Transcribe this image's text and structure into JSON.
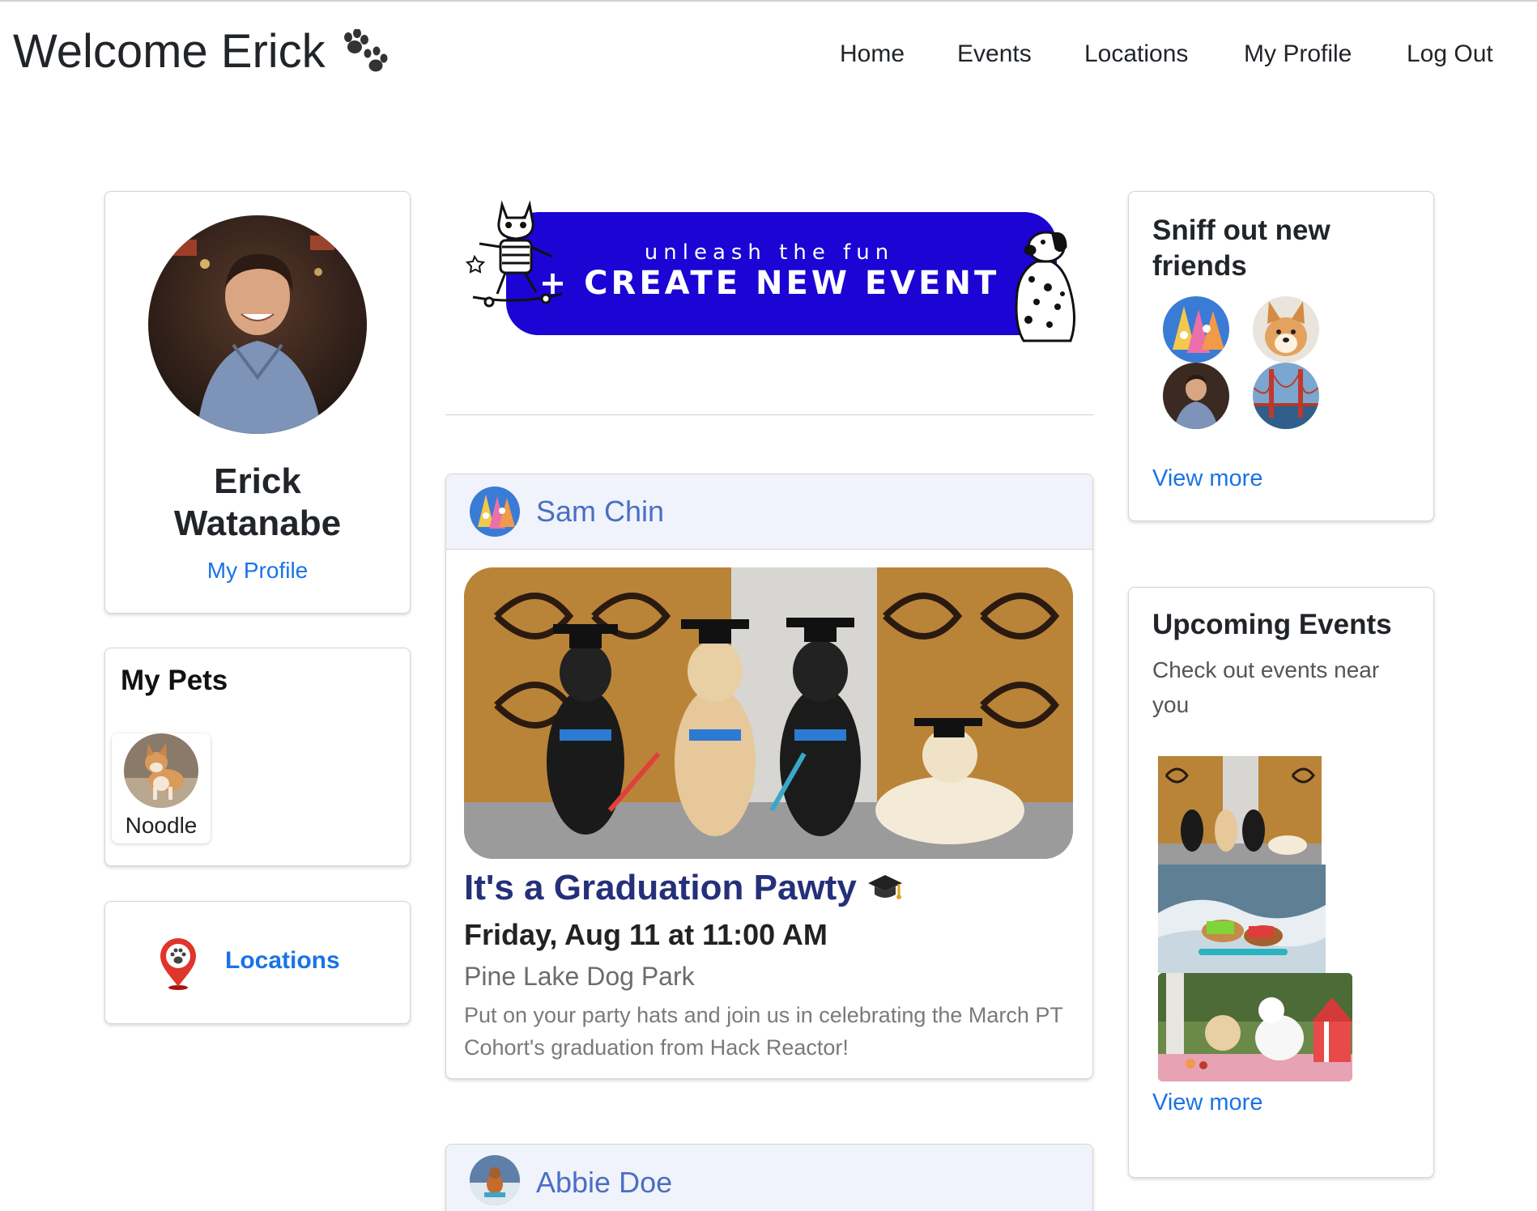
{
  "header": {
    "welcome": "Welcome Erick",
    "nav": [
      "Home",
      "Events",
      "Locations",
      "My Profile",
      "Log Out"
    ]
  },
  "profile": {
    "name": "Erick Watanabe",
    "link": "My Profile"
  },
  "pets": {
    "title": "My Pets",
    "items": [
      {
        "name": "Noodle"
      }
    ]
  },
  "locations_card": {
    "label": "Locations"
  },
  "create_event": {
    "subtitle": "unleash the fun",
    "label": "+ CREATE NEW EVENT"
  },
  "feed": [
    {
      "author": "Sam Chin",
      "title": "It's a Graduation Pawty",
      "date": "Friday, Aug 11 at 11:00 AM",
      "location": "Pine Lake Dog Park",
      "description": "Put on your party hats and join us in celebrating the March PT Cohort's graduation from Hack Reactor!"
    },
    {
      "author": "Abbie Doe"
    }
  ],
  "friends": {
    "title": "Sniff out new friends",
    "view_more": "View more"
  },
  "upcoming": {
    "title": "Upcoming Events",
    "subtitle": "Check out events near you",
    "view_more": "View more"
  },
  "colors": {
    "accent_blue": "#1a73e8",
    "banner_blue": "#1b04d4",
    "author_blue": "#4a6fc2",
    "event_title": "#25307a"
  },
  "icons": [
    "paw-icon",
    "location-pin-icon",
    "graduation-cap-icon"
  ]
}
